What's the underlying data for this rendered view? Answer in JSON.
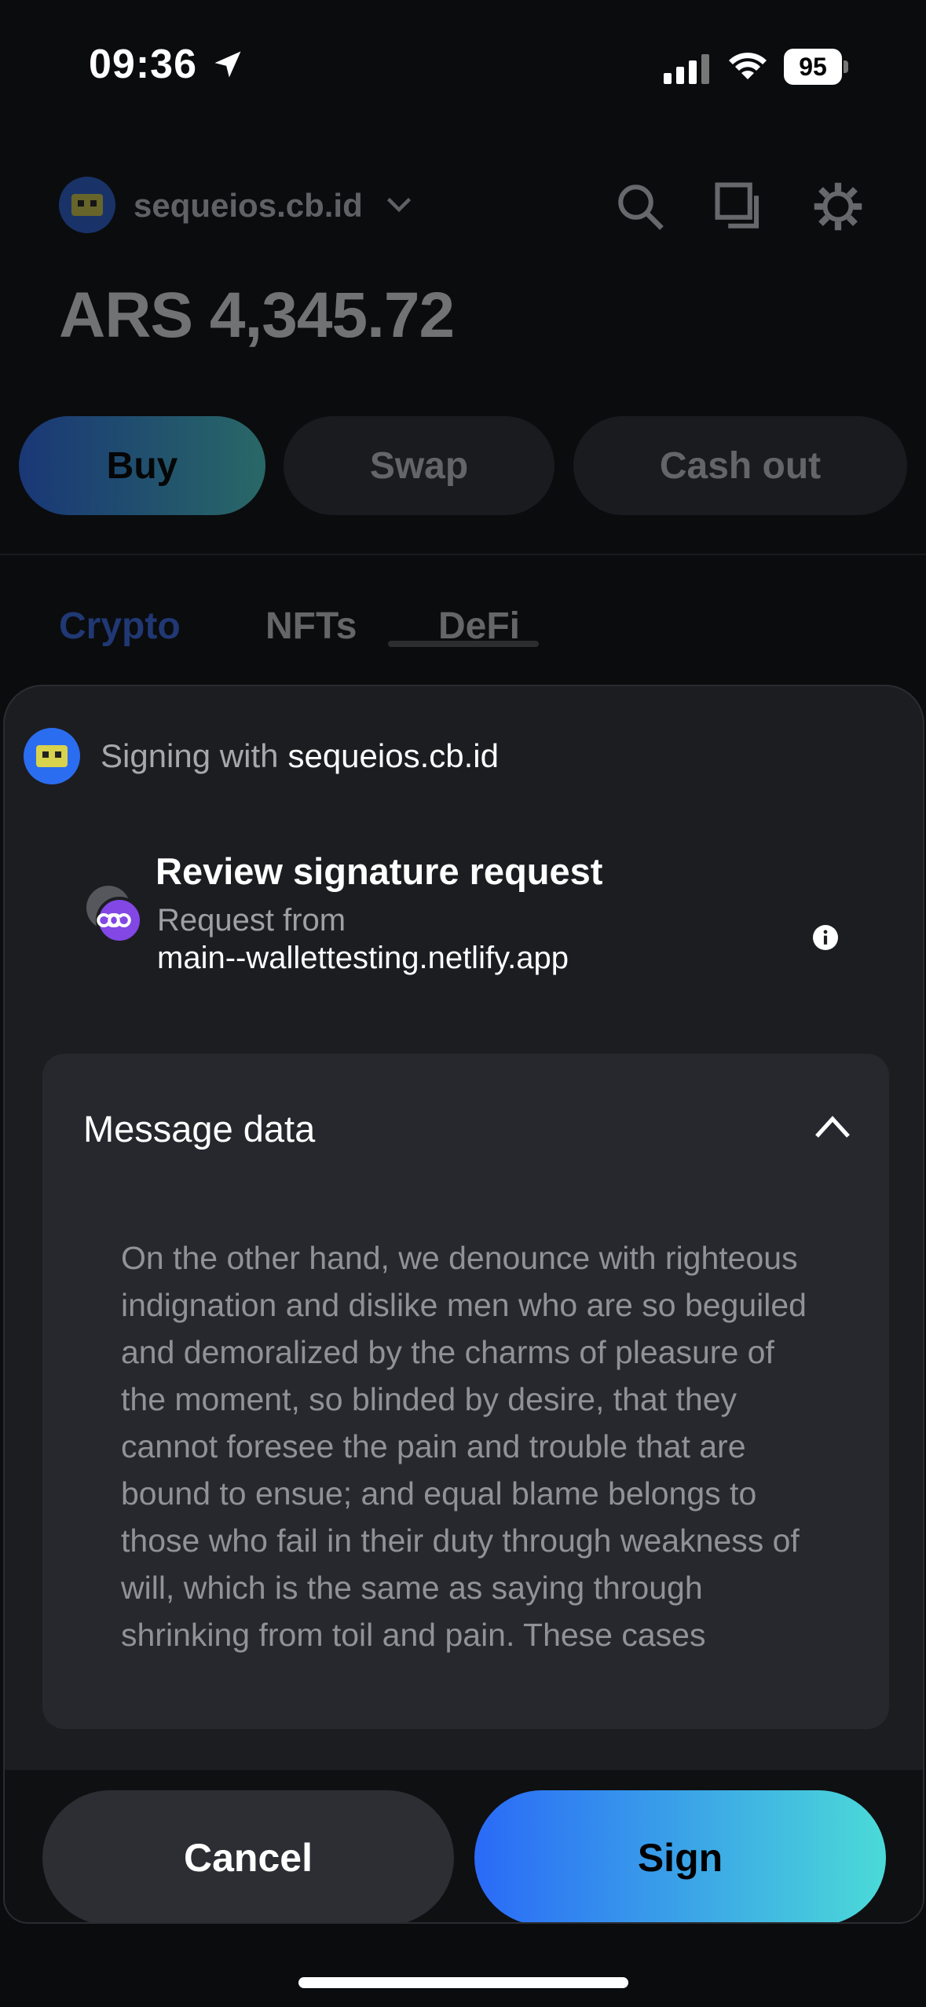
{
  "status_bar": {
    "time": "09:36",
    "battery": "95"
  },
  "header": {
    "account": "sequeios.cb.id",
    "balance": "ARS 4,345.72"
  },
  "actions": {
    "buy": "Buy",
    "swap": "Swap",
    "cash_out": "Cash out"
  },
  "tabs": [
    "Crypto",
    "NFTs",
    "DeFi"
  ],
  "sheet": {
    "signing_prefix": "Signing with",
    "signing_account": "sequeios.cb.id",
    "title": "Review signature request",
    "request_from_label": "Request from",
    "request_url": "main--wallettesting.netlify.app",
    "message_title": "Message data",
    "message_text": "On the other hand, we denounce with righteous indignation and dislike men who are so beguiled and demoralized by the charms of pleasure of the moment, so blinded by desire, that they cannot foresee the pain and trouble that are bound to ensue; and equal blame belongs to those who fail in their duty through weakness of will, which is the same as saying through shrinking from toil and pain. These cases",
    "cancel": "Cancel",
    "sign": "Sign"
  },
  "icons": {
    "location": "location-arrow-icon",
    "signal": "cellular-signal-icon",
    "wifi": "wifi-icon",
    "search": "search-icon",
    "copy": "copy-icon",
    "settings": "gear-icon",
    "chevron": "chevron-down-icon",
    "polygon": "polygon-icon",
    "info": "info-icon",
    "collapse": "chevron-up-icon"
  },
  "colors": {
    "accent_start": "#2a6af7",
    "accent_end": "#4bdad8",
    "sheet_bg": "#1c1d21",
    "card_bg": "#26282d"
  }
}
